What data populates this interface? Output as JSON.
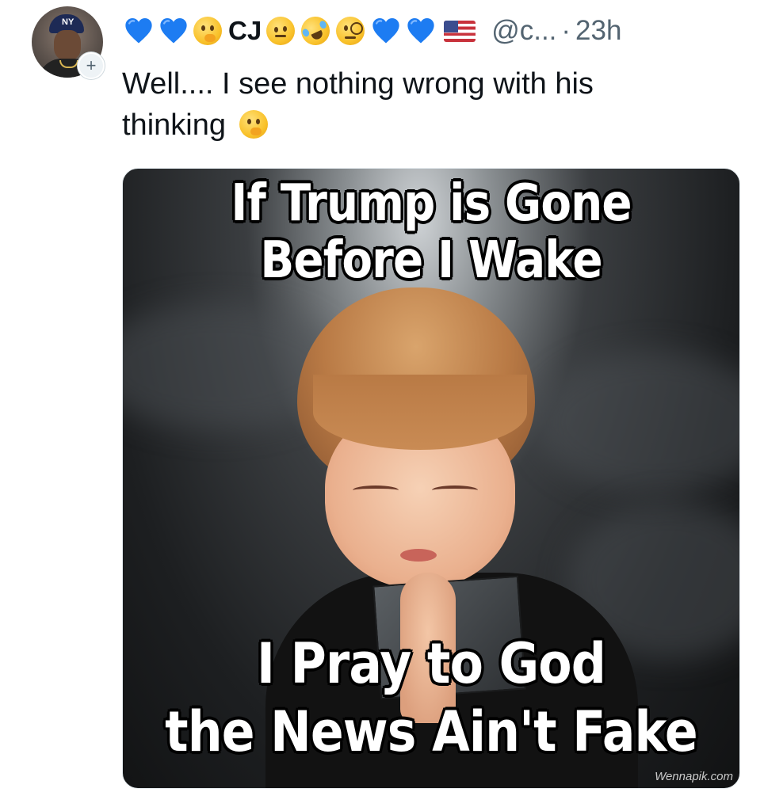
{
  "tweet": {
    "author_name": "CJ",
    "handle": "@c...",
    "separator": "·",
    "time": "23h",
    "text_line1": "Well....  I see nothing wrong with his",
    "text_line2": "thinking",
    "follow_button": "+",
    "name_decorations": [
      "blue-heart-icon",
      "blue-heart-icon",
      "thinking-face-icon",
      "name-text",
      "raised-eyebrow-face-icon",
      "rofl-face-icon",
      "monocle-face-icon",
      "blue-heart-icon",
      "blue-heart-icon",
      "us-flag-icon"
    ],
    "heart_color": "#1d7cf2"
  },
  "media": {
    "top_text_line1": "If Trump is Gone",
    "top_text_line2": "Before I Wake",
    "bottom_text_line1": "I Pray to God",
    "bottom_text_line2": "the News Ain't Fake",
    "watermark": "Wennapik.com"
  }
}
